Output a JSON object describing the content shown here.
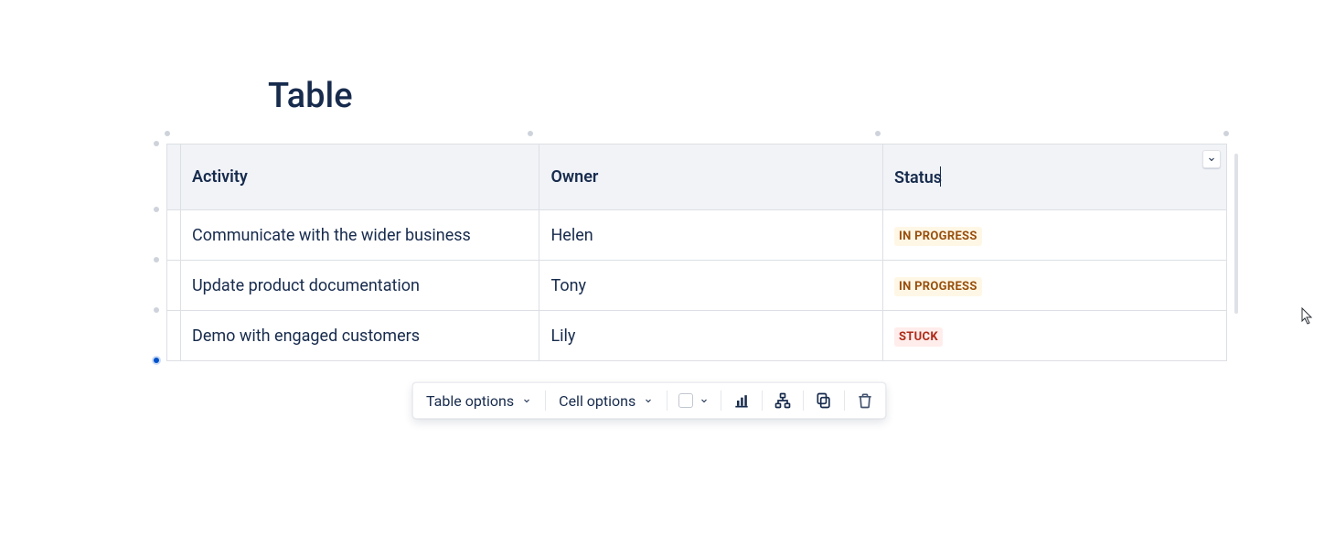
{
  "title": "Table",
  "columns": [
    "Activity",
    "Owner",
    "Status"
  ],
  "rows": [
    {
      "activity": "Communicate with the wider business",
      "owner": "Helen",
      "status": "IN PROGRESS",
      "status_kind": "inprogress"
    },
    {
      "activity": "Update product documentation",
      "owner": "Tony",
      "status": "IN PROGRESS",
      "status_kind": "inprogress"
    },
    {
      "activity": "Demo with engaged customers",
      "owner": "Lily",
      "status": "STUCK",
      "status_kind": "stuck"
    }
  ],
  "toolbar": {
    "table_options_label": "Table options",
    "cell_options_label": "Cell options"
  }
}
